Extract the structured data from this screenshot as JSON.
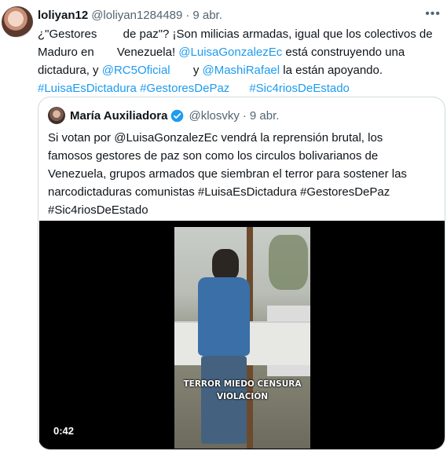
{
  "tweet": {
    "display_name": "loliyan12",
    "handle": "@loliyan1284489",
    "separator": "·",
    "time": "9 abr.",
    "more_label": "•••",
    "lines": [
      [
        {
          "t": "¿\"Gestores        de paz\"? ¡Son milicias armadas, igual que los colectivos de"
        }
      ],
      [
        {
          "t": "Maduro en       Venezuela! "
        },
        {
          "t": "@LuisaGonzalezEc",
          "link": true
        },
        {
          "t": " está construyendo una"
        }
      ],
      [
        {
          "t": "dictadura, y "
        },
        {
          "t": "@RC5Oficial",
          "link": true
        },
        {
          "t": "       y "
        },
        {
          "t": "@MashiRafael",
          "link": true
        },
        {
          "t": " la están apoyando."
        }
      ],
      [
        {
          "t": "#LuisaEsDictadura",
          "link": true
        },
        {
          "t": " "
        },
        {
          "t": "#GestoresDePaz",
          "link": true
        },
        {
          "t": "      "
        },
        {
          "t": "#Sic4riosDeEstado",
          "link": true
        }
      ]
    ]
  },
  "quote": {
    "display_name": "María Auxiliadora",
    "verified_icon": "verified-badge-icon",
    "handle": "@klosvky",
    "separator": "·",
    "time": "9 abr.",
    "lines": [
      "Si votan por @LuisaGonzalezEc vendrá la reprensión brutal, los",
      "famosos gestores de paz son como los circulos bolivarianos de",
      "Venezuela, grupos armados que siembran el terror para sostener las",
      "narcodictaduras comunistas #LuisaEsDictadura #GestoresDePaz",
      "#Sic4riosDeEstado"
    ],
    "video": {
      "caption_line1": "TERROR MIEDO CENSURA",
      "caption_line2": "VIOLACIÓN",
      "duration": "0:42"
    }
  },
  "colors": {
    "link": "#1d9bf0",
    "secondary_text": "#536471",
    "border": "#cfd9de",
    "verified": "#1d9bf0"
  }
}
